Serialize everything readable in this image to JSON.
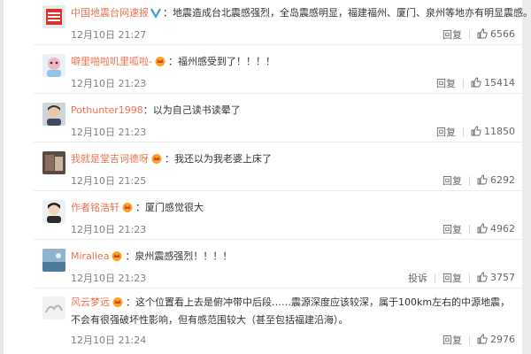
{
  "comments": [
    {
      "username": "中国地震台网速报",
      "badge": "verified-v-icon",
      "text": "：地震造成台北震感强烈，全岛震感明显，福建福州、厦门、泉州等地亦有明显震感。",
      "time": "12月10日 21:27",
      "reply": "回复",
      "likes": "6566"
    },
    {
      "username": "噼里啪啦叽里呱啦-",
      "badge": "vip-crown-icon",
      "text": "：福州感受到了！！！！",
      "time": "12月10日 21:23",
      "reply": "回复",
      "likes": "15414"
    },
    {
      "username": "Pothunter1998",
      "text": "：以为自己读书读晕了",
      "time": "12月10日 21:23",
      "reply": "回复",
      "likes": "11850"
    },
    {
      "username": "我就是堂吉诃德呀",
      "badge": "vip-crown-icon",
      "text": "：我还以为我老婆上床了",
      "time": "12月10日 21:25",
      "reply": "回复",
      "likes": "6292"
    },
    {
      "username": "作者铭浩轩",
      "badge": "vip-crown-icon",
      "text": "：厦门感觉很大",
      "time": "12月10日 21:23",
      "reply": "回复",
      "likes": "4962"
    },
    {
      "username": "Mirallea",
      "badge": "vip-crown-icon",
      "text": "：泉州震感强烈！！！！",
      "time": "12月10日 21:23",
      "report": "投诉",
      "reply": "回复",
      "likes": "3757"
    },
    {
      "username": "风云梦远",
      "badge": "vip-crown-icon",
      "text": "：这个位置看上去是俯冲带中后段……震源深度应该较深，属于100km左右的中源地震，不会有很强破坏性影响，但有感范围较大（甚至包括福建沿海）。",
      "time": "12月10日 21:24",
      "reply": "回复",
      "likes": "2976"
    }
  ]
}
